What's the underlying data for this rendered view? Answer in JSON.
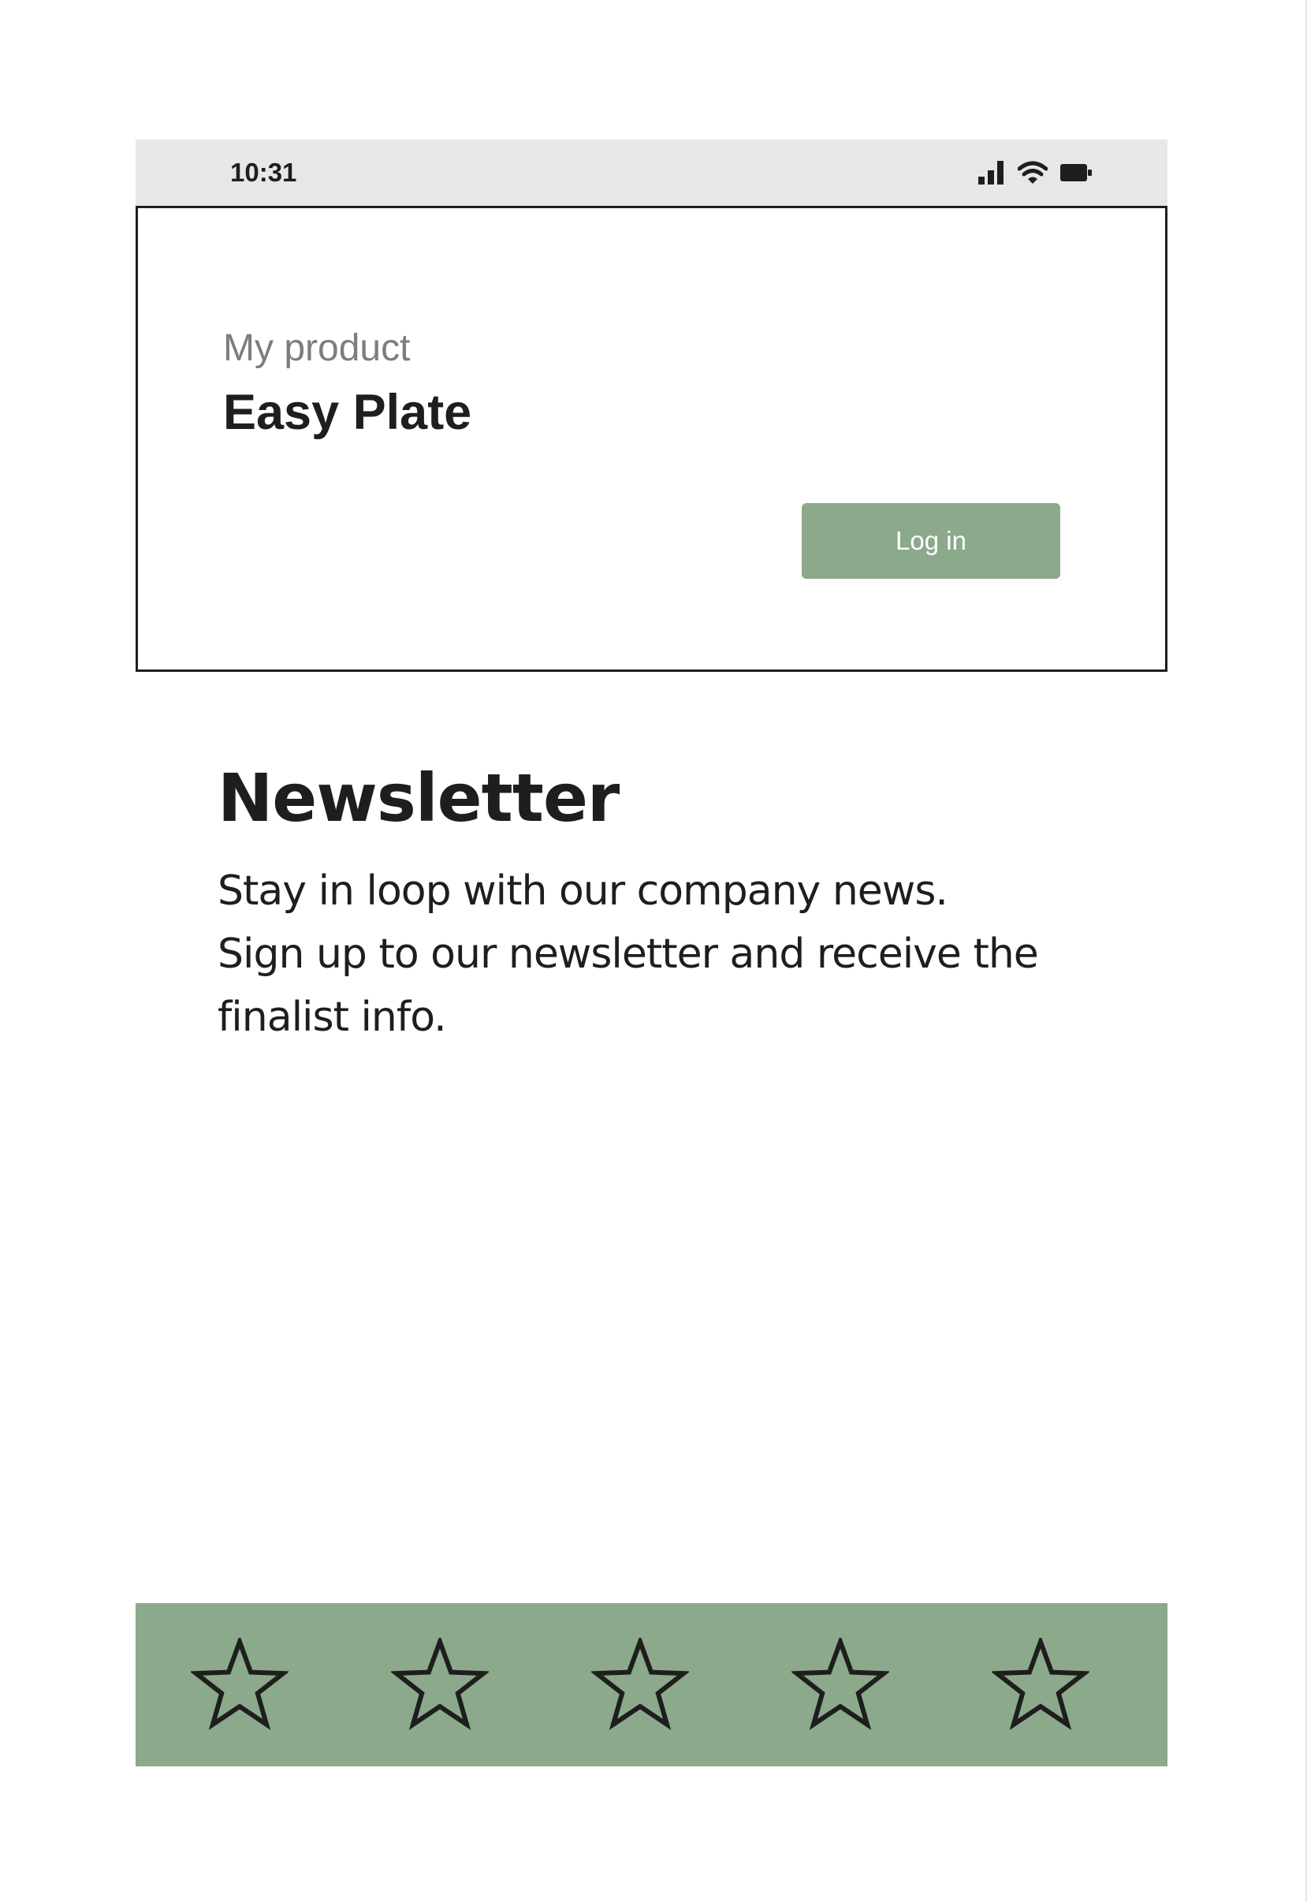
{
  "status_bar": {
    "time": "10:31",
    "icons": [
      "signal-icon",
      "wifi-icon",
      "battery-icon"
    ]
  },
  "header": {
    "product_label": "My product",
    "product_name": "Easy Plate",
    "login_label": "Log in"
  },
  "newsletter": {
    "title": "Newsletter",
    "body_lines": [
      "Stay in loop with our company news.",
      "Sign up to our newsletter and receive the",
      "finalist info."
    ]
  },
  "rating": {
    "stars_total": 5,
    "stars_filled": 0,
    "star_icon": "star-outline-icon"
  },
  "colors": {
    "accent": "#8ca98c",
    "text": "#1e1e1e",
    "muted_text": "#7d7d7d",
    "status_bar_bg": "#e7e7e7"
  }
}
